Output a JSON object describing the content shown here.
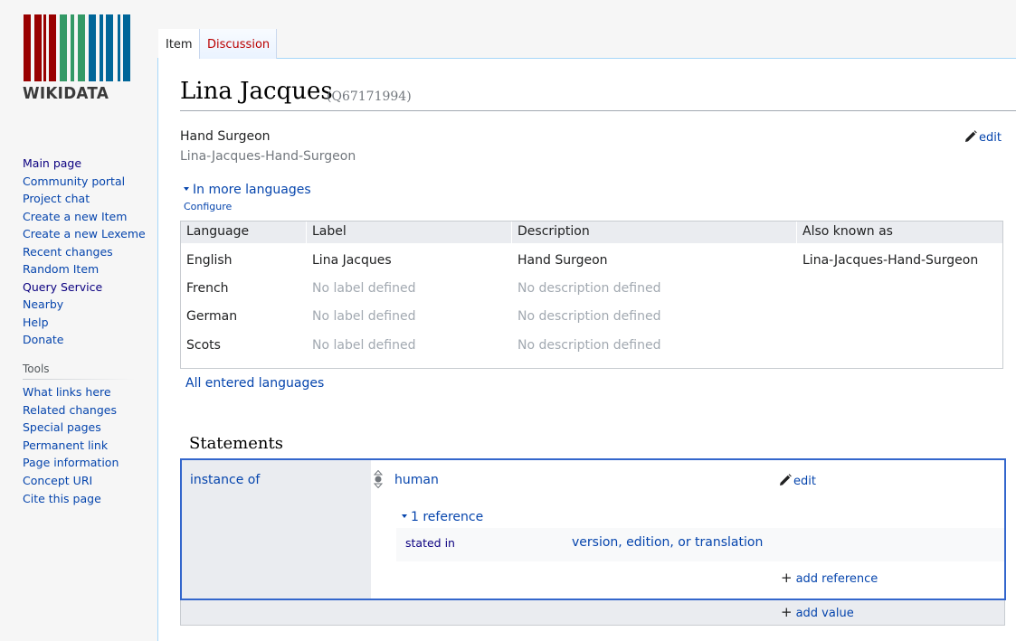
{
  "logo": {
    "wordmark": "WIKIDATA",
    "colors": [
      "#990000",
      "#339966",
      "#006699"
    ]
  },
  "sidebar": {
    "nav": [
      {
        "label": "Main page"
      },
      {
        "label": "Community portal"
      },
      {
        "label": "Project chat"
      },
      {
        "label": "Create a new Item"
      },
      {
        "label": "Create a new Lexeme"
      },
      {
        "label": "Recent changes"
      },
      {
        "label": "Random Item"
      },
      {
        "label": "Query Service"
      },
      {
        "label": "Nearby"
      },
      {
        "label": "Help"
      },
      {
        "label": "Donate"
      }
    ],
    "tools_heading": "Tools",
    "tools": [
      {
        "label": "What links here"
      },
      {
        "label": "Related changes"
      },
      {
        "label": "Special pages"
      },
      {
        "label": "Permanent link"
      },
      {
        "label": "Page information"
      },
      {
        "label": "Concept URI"
      },
      {
        "label": "Cite this page"
      }
    ]
  },
  "tabs": [
    {
      "label": "Item"
    },
    {
      "label": "Discussion"
    }
  ],
  "page": {
    "title": "Lina Jacques",
    "id": "(Q67171994)",
    "description": "Hand Surgeon",
    "alias": "Lina-Jacques-Hand-Surgeon",
    "edit_label": "edit",
    "more_languages": "In more languages",
    "configure": "Configure",
    "all_languages": "All entered languages"
  },
  "languages": {
    "headers": [
      "Language",
      "Label",
      "Description",
      "Also known as"
    ],
    "rows": [
      [
        "English",
        "Lina Jacques",
        "Hand Surgeon",
        "Lina-Jacques-Hand-Surgeon"
      ],
      [
        "French",
        "No label defined",
        "No description defined",
        ""
      ],
      [
        "German",
        "No label defined",
        "No description defined",
        ""
      ],
      [
        "Scots",
        "No label defined",
        "No description defined",
        ""
      ]
    ]
  },
  "statements": {
    "heading": "Statements",
    "property": "instance of",
    "value": "human",
    "edit_label": "edit",
    "references_toggle": "1 reference",
    "reference_property": "stated in",
    "reference_value": "version, edition, or translation",
    "add_reference": "add reference",
    "add_value": "add value",
    "plus": "+"
  }
}
